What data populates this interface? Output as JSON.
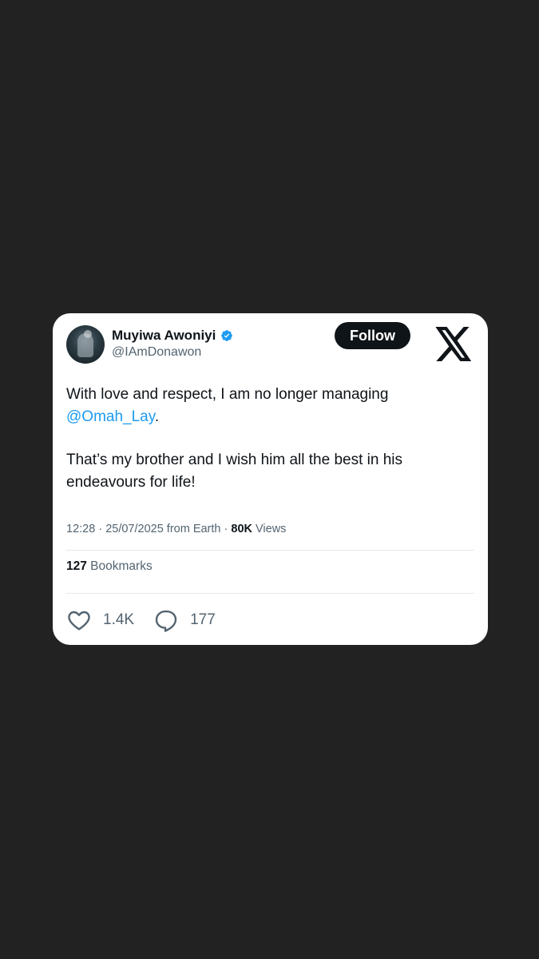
{
  "tweet": {
    "author": {
      "display_name": "Muyiwa Awoniyi",
      "handle": "@IAmDonawon",
      "verified": true,
      "verified_color": "#1d9bf0"
    },
    "follow_label": "Follow",
    "text_line1": "With love and respect, I am no longer managing",
    "mention": "@Omah_Lay",
    "mention_suffix": ".",
    "text_paragraph2": "That’s my brother and I wish him all the best in his endeavours for life!",
    "meta": {
      "time": "12:28",
      "sep1": " · ",
      "date": "25/07/2025",
      "location": " from Earth",
      "sep2": " · ",
      "views_count": "80K",
      "views_label": " Views"
    },
    "bookmarks": {
      "count": "127",
      "label": " Bookmarks"
    },
    "actions": {
      "likes": "1.4K",
      "replies": "177"
    }
  },
  "colors": {
    "background": "#222222",
    "card": "#ffffff",
    "text": "#0f1419",
    "secondary": "#536471",
    "link": "#1d9bf0"
  },
  "icons": [
    "avatar",
    "verified-badge-icon",
    "x-logo-icon",
    "heart-icon",
    "reply-bubble-icon"
  ]
}
